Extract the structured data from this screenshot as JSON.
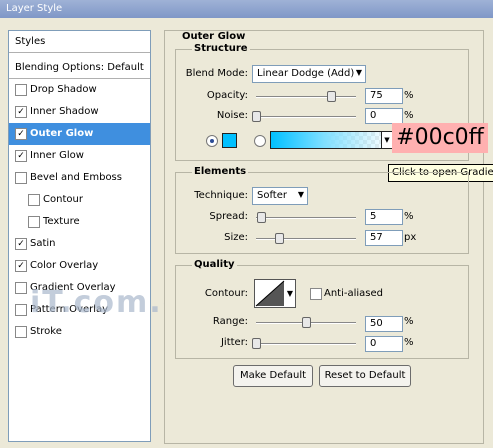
{
  "window": {
    "title": "Layer Style"
  },
  "left_panel": {
    "styles_header": "Styles",
    "blending_options": "Blending Options: Default",
    "items": [
      {
        "label": "Drop Shadow",
        "checked": false,
        "sub": false,
        "selected": false
      },
      {
        "label": "Inner Shadow",
        "checked": true,
        "sub": false,
        "selected": false
      },
      {
        "label": "Outer Glow",
        "checked": true,
        "sub": false,
        "selected": true
      },
      {
        "label": "Inner Glow",
        "checked": true,
        "sub": false,
        "selected": false
      },
      {
        "label": "Bevel and Emboss",
        "checked": false,
        "sub": false,
        "selected": false
      },
      {
        "label": "Contour",
        "checked": false,
        "sub": true,
        "selected": false
      },
      {
        "label": "Texture",
        "checked": false,
        "sub": true,
        "selected": false
      },
      {
        "label": "Satin",
        "checked": true,
        "sub": false,
        "selected": false
      },
      {
        "label": "Color Overlay",
        "checked": true,
        "sub": false,
        "selected": false
      },
      {
        "label": "Gradient Overlay",
        "checked": false,
        "sub": false,
        "selected": false
      },
      {
        "label": "Pattern Overlay",
        "checked": false,
        "sub": false,
        "selected": false
      },
      {
        "label": "Stroke",
        "checked": false,
        "sub": false,
        "selected": false
      }
    ]
  },
  "watermark": "iT.com.cn",
  "outer_glow": {
    "title": "Outer Glow",
    "structure": {
      "title": "Structure",
      "blend_mode_label": "Blend Mode:",
      "blend_mode_value": "Linear Dodge (Add)",
      "opacity_label": "Opacity:",
      "opacity_value": "75",
      "opacity_level": 0.75,
      "noise_label": "Noise:",
      "noise_value": "0",
      "noise_level": 0,
      "percent": "%",
      "glow_color": "#00c0ff",
      "hex_annotation": "#00c0ff",
      "tooltip": "Click to open Gradient Editor"
    },
    "elements": {
      "title": "Elements",
      "technique_label": "Technique:",
      "technique_value": "Softer",
      "spread_label": "Spread:",
      "spread_value": "5",
      "spread_level": 0.05,
      "size_label": "Size:",
      "size_value": "57",
      "size_level": 0.23,
      "percent": "%",
      "px": "px"
    },
    "quality": {
      "title": "Quality",
      "contour_label": "Contour:",
      "anti_aliased_label": "Anti-aliased",
      "anti_aliased_checked": false,
      "range_label": "Range:",
      "range_value": "50",
      "range_level": 0.5,
      "jitter_label": "Jitter:",
      "jitter_value": "0",
      "jitter_level": 0,
      "percent": "%"
    },
    "buttons": {
      "make_default": "Make Default",
      "reset_default": "Reset to Default"
    }
  },
  "colors": {
    "selection": "#3f8fdf",
    "glow": "#00c0ff",
    "hex_highlight": "#ffb0b0"
  }
}
